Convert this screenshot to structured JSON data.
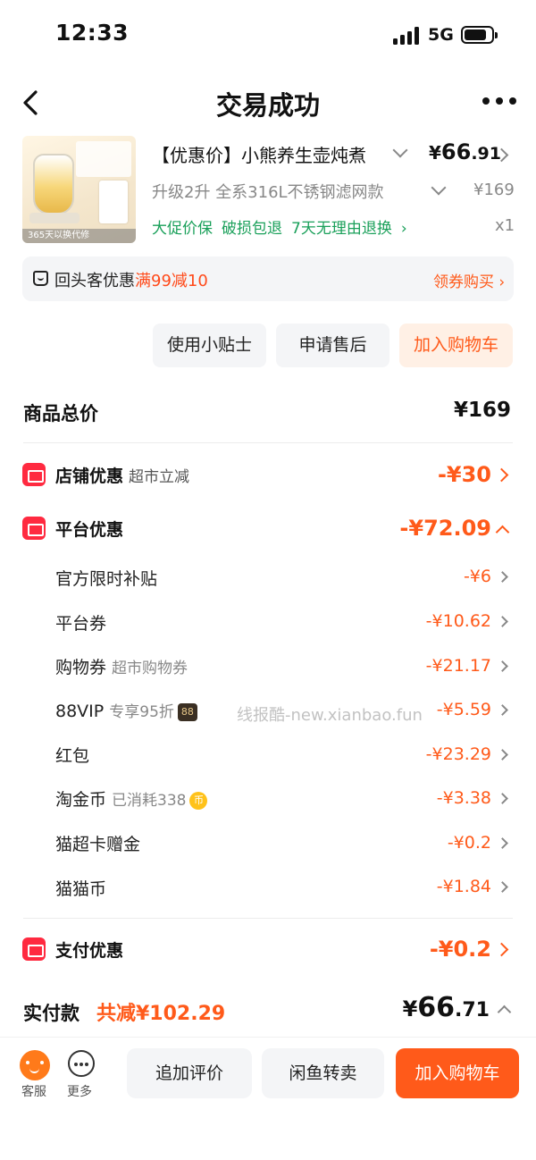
{
  "status": {
    "time": "12:33",
    "network": "5G"
  },
  "nav": {
    "title": "交易成功"
  },
  "product": {
    "image_strip": "365天以换代修",
    "name": "【优惠价】小熊养生壶炖煮",
    "price_currency": "¥",
    "price_int": "66",
    "price_dec": ".91",
    "spec": "升级2升 全系316L不锈钢滤网款",
    "original_price": "¥169",
    "services": [
      "大促价保",
      "破损包退",
      "7天无理由退换"
    ],
    "quantity": "x1"
  },
  "coupon": {
    "label": "回头客优惠",
    "highlight": "满99减10",
    "action": "领券购买"
  },
  "actions": {
    "tips": "使用小贴士",
    "aftersale": "申请售后",
    "add_cart": "加入购物车"
  },
  "summary": {
    "goods_total_label": "商品总价",
    "goods_total_value": "¥169",
    "store": {
      "label": "店铺优惠",
      "sub": "超市立减",
      "value": "-¥30"
    },
    "platform": {
      "label": "平台优惠",
      "value": "-¥72.09",
      "items": [
        {
          "label": "官方限时补贴",
          "note": "",
          "value": "-¥6"
        },
        {
          "label": "平台券",
          "note": "",
          "value": "-¥10.62"
        },
        {
          "label": "购物券",
          "note": "超市购物券",
          "value": "-¥21.17"
        },
        {
          "label": "88VIP",
          "note": "专享95折",
          "value": "-¥5.59"
        },
        {
          "label": "红包",
          "note": "",
          "value": "-¥23.29"
        },
        {
          "label": "淘金币",
          "note": "已消耗338",
          "value": "-¥3.38"
        },
        {
          "label": "猫超卡赠金",
          "note": "",
          "value": "-¥0.2"
        },
        {
          "label": "猫猫币",
          "note": "",
          "value": "-¥1.84"
        }
      ],
      "vip_badge": "88",
      "coin_badge": "币"
    },
    "payment": {
      "label": "支付优惠",
      "value": "-¥0.2"
    },
    "total_label": "实付款",
    "total_saved": "共减¥102.29",
    "total_currency": "¥",
    "total_int": "66",
    "total_dec": ".71"
  },
  "watermark": "线报酷-new.xianbao.fun",
  "bottom": {
    "service": "客服",
    "more": "更多",
    "review": "追加评价",
    "resell": "闲鱼转卖",
    "add_cart": "加入购物车"
  },
  "colors": {
    "accent": "#ff5a1a",
    "green": "#1aa05a",
    "red_icon": "#ff2a40"
  }
}
